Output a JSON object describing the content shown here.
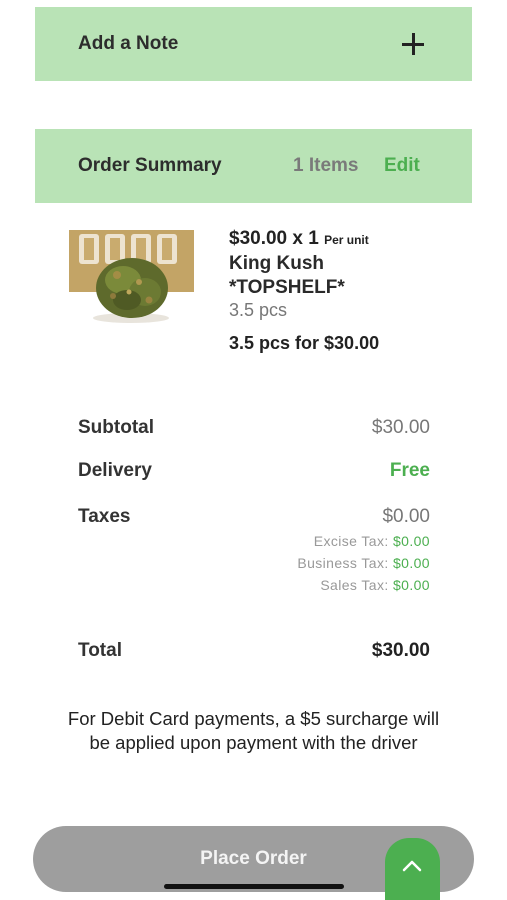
{
  "note": {
    "label": "Add a Note",
    "icon": "plus-icon"
  },
  "order_summary": {
    "label": "Order Summary",
    "items_count": "1 Items",
    "edit_label": "Edit"
  },
  "product": {
    "price": "$30.00 x 1",
    "price_unit": "Per unit",
    "name": "King Kush *TOPSHELF*",
    "quantity": "3.5 pcs",
    "bundle": "3.5 pcs for $30.00"
  },
  "totals": {
    "subtotal_label": "Subtotal",
    "subtotal_value": "$30.00",
    "delivery_label": "Delivery",
    "delivery_value": "Free",
    "taxes_label": "Taxes",
    "taxes_value": "$0.00",
    "tax_breakdown": [
      {
        "label": "Excise Tax:",
        "value": "$0.00"
      },
      {
        "label": "Business Tax:",
        "value": "$0.00"
      },
      {
        "label": "Sales Tax:",
        "value": "$0.00"
      }
    ],
    "total_label": "Total",
    "total_value": "$30.00"
  },
  "surcharge_note": "For Debit Card payments, a $5 surcharge will be applied upon payment with the driver",
  "place_order_label": "Place Order",
  "colors": {
    "panel_bg": "#b9e3b6",
    "accent_green": "#4caf50",
    "button_grey": "#9e9e9e"
  }
}
